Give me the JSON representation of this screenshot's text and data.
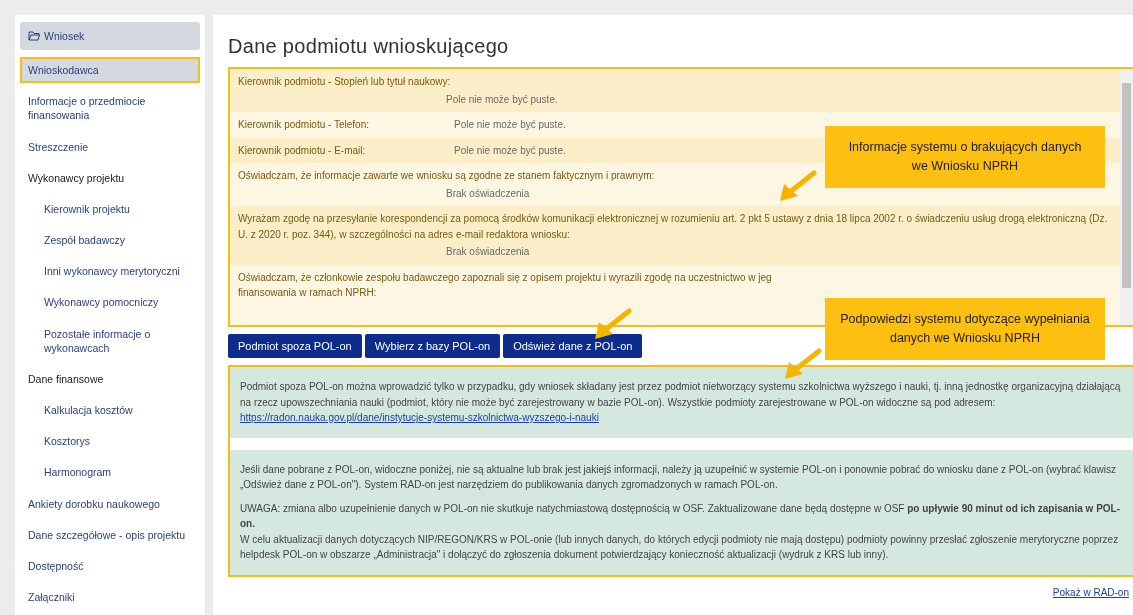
{
  "sidebar": {
    "header": "Wniosek",
    "items": [
      {
        "label": "Wnioskodawca",
        "selected": true
      },
      {
        "label": "Informacje o przedmiocie finansowania",
        "selected": false
      },
      {
        "label": "Streszczenie",
        "selected": false
      },
      {
        "label": "Wykonawcy projektu",
        "selected": false,
        "children": [
          {
            "label": "Kierownik projektu",
            "selected": false
          },
          {
            "label": "Zespół badawczy",
            "selected": false
          },
          {
            "label": "Inni wykonawcy merytoryczni",
            "selected": false
          },
          {
            "label": "Wykonawcy pomocniczy",
            "selected": false
          },
          {
            "label": "Pozostałe informacje o wykonawcach",
            "selected": false
          }
        ]
      },
      {
        "label": "Dane finansowe",
        "selected": false,
        "children": [
          {
            "label": "Kalkulacja kosztów",
            "selected": false
          },
          {
            "label": "Kosztorys",
            "selected": false
          },
          {
            "label": "Harmonogram",
            "selected": false
          }
        ]
      },
      {
        "label": "Ankiety dorobku naukowego",
        "selected": false
      },
      {
        "label": "Dane szczegółowe - opis projektu",
        "selected": false
      },
      {
        "label": "Dostępność",
        "selected": false
      },
      {
        "label": "Załączniki",
        "selected": false
      }
    ]
  },
  "title": "Dane podmiotu wnioskującego",
  "warnings": [
    {
      "kind": "stacked",
      "label": "Kierownik podmiotu - Stopień lub tytuł naukowy:",
      "message": "Pole nie może być puste."
    },
    {
      "kind": "inline",
      "label": "Kierownik podmiotu - Telefon:",
      "message": "Pole nie może być puste."
    },
    {
      "kind": "inline",
      "label": "Kierownik podmiotu - E-mail:",
      "message": "Pole nie może być puste."
    },
    {
      "kind": "stacked",
      "label": "Oświadczam, że informacje zawarte we wniosku są zgodne ze stanem faktycznym i prawnym:",
      "message": "Brak oświadczenia"
    },
    {
      "kind": "stacked",
      "label": "Wyrażam zgodę na przesyłanie korespondencji za pomocą środków komunikacji elektronicznej w rozumieniu art. 2 pkt 5 ustawy z dnia 18 lipca 2002 r. o świadczeniu usług drogą elektroniczną (Dz. U. z 2020 r. poz. 344), w szczególności na adres e-mail redaktora wniosku:",
      "message": "Brak oświadczenia"
    },
    {
      "kind": "partial",
      "lines": [
        "Oświadczam, że członkowie zespołu badawczego zapoznali się z opisem projektu i wyrazili zgodę na uczestnictwo w jeg",
        "finansowania w ramach NPRH:"
      ]
    }
  ],
  "buttons": [
    "Podmiot spoza POL-on",
    "Wybierz z bazy POL-on",
    "Odśwież dane z POL-on"
  ],
  "info_sections": [
    {
      "paragraphs": [
        {
          "text": "Podmiot spoza POL-on można wprowadzić tylko w przypadku, gdy wniosek składany jest przez podmiot nietworzący systemu szkolnictwa wyższego i nauki, tj. inną jednostkę organizacyjną działającą na rzecz upowszechniania nauki (podmiot, który nie może być zarejestrowany w bazie POL-on). Wszystkie podmioty zarejestrowane w POL-on widoczne są pod adresem:",
          "link": "https://radon.nauka.gov.pl/dane/instytucje-systemu-szkolnictwa-wyzszego-i-nauki"
        }
      ]
    },
    {
      "paragraphs": [
        {
          "text": "Jeśli dane pobrane z POL-on, widoczne poniżej, nie są aktualne lub brak jest jakiejś informacji, należy ją uzupełnić w systemie POL-on i ponownie pobrać do wniosku dane z POL-on (wybrać klawisz „Odśwież dane z POL-on\"). System RAD-on jest narzędziem do publikowania danych zgromadzonych w ramach POL-on."
        },
        {
          "text": "UWAGA: zmiana albo uzupełnienie danych w POL-on nie skutkuje natychmiastową dostępnością w OSF. Zaktualizowane dane będą dostępne w OSF **po upływie 90 minut od ich zapisania w POL-on.**\nW celu aktualizacji danych dotyczących NIP/REGON/KRS w POL-onie (lub innych danych, do których edycji podmioty nie mają dostępu) podmioty powinny przesłać zgłoszenie merytoryczne poprzez helpdesk POL-on w obszarze „Administracja\" i dołączyć do zgłoszenia dokument potwierdzający konieczność aktualizacji (wydruk z KRS lub inny)."
        }
      ]
    }
  ],
  "footer_link": "Pokaż w RAD-on",
  "callouts": [
    "Informacje systemu o brakujących danych we Wniosku NPRH",
    "Podpowiedzi systemu dotyczące wypełniania danych we Wniosku NPRH"
  ]
}
